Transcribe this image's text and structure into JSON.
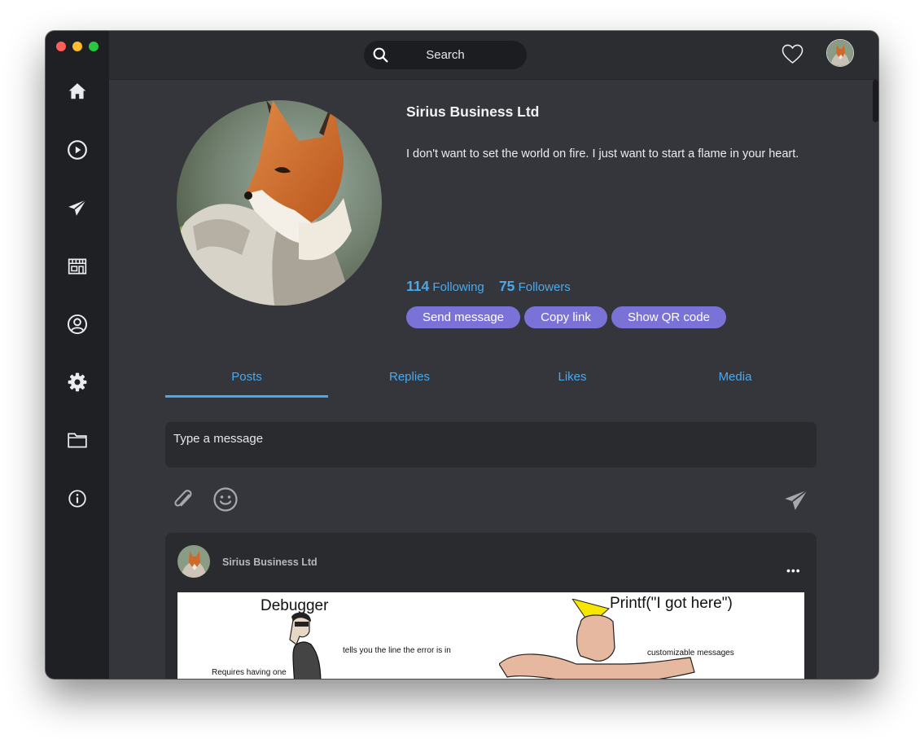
{
  "window": {
    "traffic_lights": [
      "close",
      "minimize",
      "zoom"
    ]
  },
  "sidebar": {
    "items": [
      {
        "icon": "home-icon"
      },
      {
        "icon": "play-circle-icon"
      },
      {
        "icon": "paper-plane-icon"
      },
      {
        "icon": "store-icon"
      },
      {
        "icon": "user-circle-icon"
      },
      {
        "icon": "gear-icon"
      },
      {
        "icon": "folder-icon"
      },
      {
        "icon": "info-icon"
      }
    ]
  },
  "topbar": {
    "search_label": "Search",
    "icons": [
      "search-icon",
      "heart-icon",
      "avatar"
    ]
  },
  "profile": {
    "name": "Sirius Business Ltd",
    "bio": "I don't want to set the world on fire. I just want to start a flame in your heart.",
    "following_count": "114",
    "following_label": "Following",
    "followers_count": "75",
    "followers_label": "Followers",
    "buttons": {
      "send_message": "Send message",
      "copy_link": "Copy link",
      "show_qr": "Show QR code"
    }
  },
  "tabs": [
    {
      "label": "Posts",
      "active": true
    },
    {
      "label": "Replies",
      "active": false
    },
    {
      "label": "Likes",
      "active": false
    },
    {
      "label": "Media",
      "active": false
    }
  ],
  "composer": {
    "placeholder": "Type a message",
    "icons": [
      "paperclip-icon",
      "emoji-icon",
      "send-icon"
    ]
  },
  "post": {
    "author": "Sirius Business Ltd",
    "more_label": "•••",
    "image": {
      "left_title": "Debugger",
      "left_caption_1": "tells you the line the error is in",
      "left_caption_2": "Requires having one",
      "right_title": "Printf(\"I got here\")",
      "right_caption_1": "customizable messages"
    }
  },
  "colors": {
    "accent": "#4aa9ec",
    "button": "#7a72d6",
    "background": "#35363b",
    "sidebar": "#1f2024"
  }
}
